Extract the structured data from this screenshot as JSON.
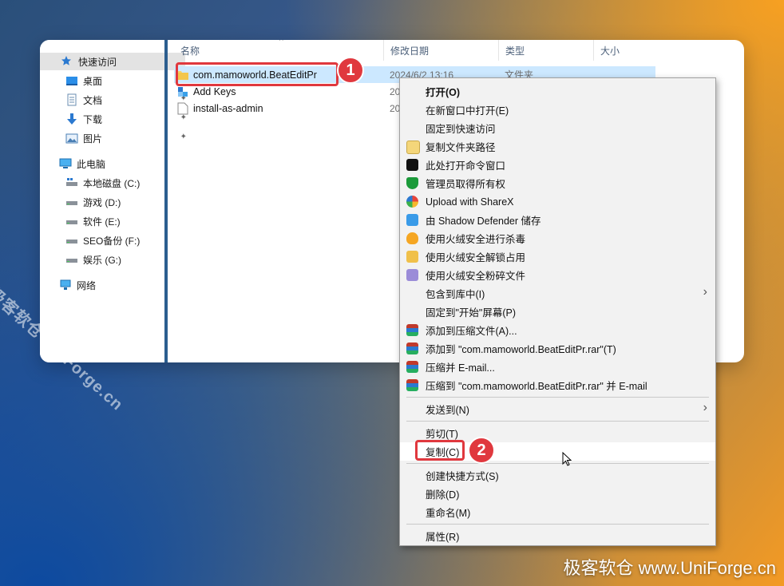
{
  "nav": {
    "quick_access": "快速访问",
    "desktop": "桌面",
    "documents": "文档",
    "downloads": "下载",
    "pictures": "图片",
    "this_pc": "此电脑",
    "drive_c": "本地磁盘 (C:)",
    "drive_d": "游戏 (D:)",
    "drive_e": "软件 (E:)",
    "drive_f": "SEO备份 (F:)",
    "drive_g": "娱乐 (G:)",
    "network": "网络",
    "pin_glyph": "📌"
  },
  "columns": {
    "name": "名称",
    "date": "修改日期",
    "type": "类型",
    "size": "大小"
  },
  "files": [
    {
      "name": "com.mamoworld.BeatEditPr",
      "date": "2024/6/2 13:16",
      "type": "文件夹",
      "icon": "folder-icon"
    },
    {
      "name": "Add Keys",
      "date": "20",
      "type": "",
      "icon": "registry-icon"
    },
    {
      "name": "install-as-admin",
      "date": "20",
      "type": "",
      "icon": "file-icon"
    }
  ],
  "callouts": {
    "one": "1",
    "two": "2"
  },
  "menu": {
    "open": "打开(O)",
    "open_new_window": "在新窗口中打开(E)",
    "pin_quick_access": "固定到快速访问",
    "copy_path": "复制文件夹路径",
    "open_cmd": "此处打开命令窗口",
    "take_ownership": "管理员取得所有权",
    "sharex": "Upload with ShareX",
    "shadow_defender": "由 Shadow Defender 储存",
    "huorong_scan": "使用火绒安全进行杀毒",
    "huorong_unlock": "使用火绒安全解锁占用",
    "huorong_shred": "使用火绒安全粉碎文件",
    "include_library": "包含到库中(I)",
    "pin_start": "固定到\"开始\"屏幕(P)",
    "add_archive": "添加到压缩文件(A)...",
    "add_rar": "添加到 \"com.mamoworld.BeatEditPr.rar\"(T)",
    "compress_email": "压缩并 E-mail...",
    "compress_rar_email": "压缩到 \"com.mamoworld.BeatEditPr.rar\" 并 E-mail",
    "send_to": "发送到(N)",
    "cut": "剪切(T)",
    "copy": "复制(C)",
    "create_shortcut": "创建快捷方式(S)",
    "delete": "删除(D)",
    "rename": "重命名(M)",
    "properties": "属性(R)"
  },
  "watermark": {
    "diagonal": "极客软仓 UniForge.cn",
    "corner": "极客软仓 www.UniForge.cn"
  }
}
